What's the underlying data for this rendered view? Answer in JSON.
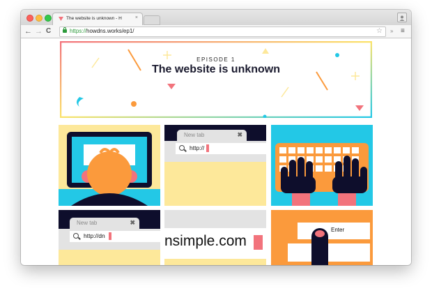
{
  "browser": {
    "tab_title": "The website is unknown - H",
    "tab_close": "×",
    "url_scheme": "https://",
    "url_rest": "howdns.works/ep1/",
    "nav_back": "←",
    "nav_forward": "→",
    "nav_reload": "C",
    "star": "☆",
    "extension": "»",
    "menu": "≡"
  },
  "hero": {
    "episode": "EPISODE 1",
    "title": "The website is unknown"
  },
  "panels": {
    "p2_tab_label": "New tab",
    "p2_tab_close": "✖",
    "p2_url_text": "http://",
    "p4_tab_label": "New tab",
    "p4_tab_close": "✖",
    "p4_url_text": "http://dn",
    "p5_big_text": "nsimple.com",
    "p6_key_label": "Enter"
  },
  "colors": {
    "accent_pink": "#f2737c",
    "cyan": "#23c8e6",
    "yellow": "#fde89a",
    "orange": "#fb9a3c",
    "navy": "#0e0e2c"
  }
}
